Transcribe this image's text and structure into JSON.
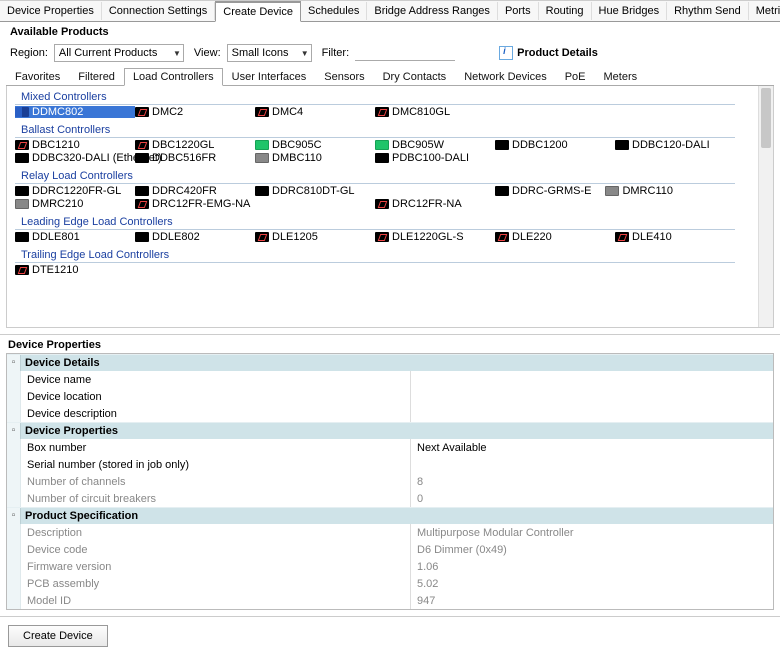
{
  "mainTabs": {
    "items": [
      "Device Properties",
      "Connection Settings",
      "Create Device",
      "Schedules",
      "Bridge Address Ranges",
      "Ports",
      "Routing",
      "Hue Bridges",
      "Rhythm Send",
      "Metrics"
    ],
    "active": "Create Device"
  },
  "panel": {
    "title": "Available Products"
  },
  "filters": {
    "regionLabel": "Region:",
    "regionValue": "All Current Products",
    "viewLabel": "View:",
    "viewValue": "Small Icons",
    "filterLabel": "Filter:",
    "filterValue": "",
    "productDetailsLabel": "Product Details"
  },
  "subTabs": {
    "items": [
      "Favorites",
      "Filtered",
      "Load Controllers",
      "User Interfaces",
      "Sensors",
      "Dry Contacts",
      "Network Devices",
      "PoE",
      "Meters"
    ],
    "active": "Load Controllers"
  },
  "productGroups": [
    {
      "header": "Mixed Controllers",
      "items": [
        {
          "label": "DDMC802",
          "icon": "blue",
          "selected": true
        },
        {
          "label": "DMC2",
          "icon": "black"
        },
        {
          "label": "DMC4",
          "icon": "black"
        },
        {
          "label": "DMC810GL",
          "icon": "black"
        }
      ]
    },
    {
      "header": "Ballast Controllers",
      "items": [
        {
          "label": "DBC1210",
          "icon": "black"
        },
        {
          "label": "DBC1220GL",
          "icon": "black"
        },
        {
          "label": "DBC905C",
          "icon": "green"
        },
        {
          "label": "DBC905W",
          "icon": "green"
        },
        {
          "label": "DDBC1200",
          "icon": "darkb"
        },
        {
          "label": "DDBC120-DALI",
          "icon": "darkb"
        },
        {
          "label": "DDBC320-DALI (Ethernet)",
          "icon": "darkb",
          "wide": true
        },
        {
          "label": "DDBC516FR",
          "icon": "darkb"
        },
        {
          "label": "DMBC110",
          "icon": "grayb"
        },
        {
          "label": "PDBC100-DALI",
          "icon": "darkb"
        }
      ]
    },
    {
      "header": "Relay Load Controllers",
      "layout": "five",
      "items": [
        {
          "label": "DDRC1220FR-GL",
          "icon": "darkb"
        },
        {
          "label": "DDRC420FR",
          "icon": "darkb"
        },
        {
          "label": "DDRC810DT-GL",
          "icon": "darkb"
        },
        {
          "label": "",
          "icon": "",
          "blank": true
        },
        {
          "label": "DDRC-GRMS-E",
          "icon": "darkb",
          "inlineExtra": {
            "label": "DMRC110",
            "icon": "grayb"
          }
        },
        {
          "label": "",
          "icon": "",
          "blank": true
        },
        {
          "label": "DMRC210",
          "icon": "grayb"
        },
        {
          "label": "DRC12FR-EMG-NA",
          "icon": "black"
        },
        {
          "label": "",
          "icon": "",
          "blank": true
        },
        {
          "label": "DRC12FR-NA",
          "icon": "black"
        }
      ]
    },
    {
      "header": "Leading Edge Load Controllers",
      "items": [
        {
          "label": "DDLE801",
          "icon": "darkb"
        },
        {
          "label": "DDLE802",
          "icon": "darkb"
        },
        {
          "label": "DLE1205",
          "icon": "black"
        },
        {
          "label": "DLE1220GL-S",
          "icon": "black"
        },
        {
          "label": "DLE220",
          "icon": "black"
        },
        {
          "label": "DLE410",
          "icon": "black"
        }
      ]
    },
    {
      "header": "Trailing Edge Load Controllers",
      "items": [
        {
          "label": "DTE1210",
          "icon": "black"
        }
      ]
    }
  ],
  "propPanelTitle": "Device Properties",
  "propGrid": [
    {
      "category": "Device Details",
      "rows": [
        {
          "key": "Device name",
          "val": ""
        },
        {
          "key": "Device location",
          "val": ""
        },
        {
          "key": "Device description",
          "val": ""
        }
      ]
    },
    {
      "category": "Device Properties",
      "rows": [
        {
          "key": "Box number",
          "val": "Next Available"
        },
        {
          "key": "Serial number (stored in job only)",
          "val": ""
        },
        {
          "key": "Number of channels",
          "val": "8",
          "ro": true
        },
        {
          "key": "Number of circuit breakers",
          "val": "0",
          "ro": true
        }
      ]
    },
    {
      "category": "Product Specification",
      "rows": [
        {
          "key": "Description",
          "val": "Multipurpose Modular Controller",
          "ro": true
        },
        {
          "key": "Device code",
          "val": "D6 Dimmer (0x49)",
          "ro": true
        },
        {
          "key": "Firmware version",
          "val": "1.06",
          "ro": true
        },
        {
          "key": "PCB assembly",
          "val": "5.02",
          "ro": true
        },
        {
          "key": "Model ID",
          "val": "947",
          "ro": true
        }
      ]
    }
  ],
  "createButton": "Create Device"
}
